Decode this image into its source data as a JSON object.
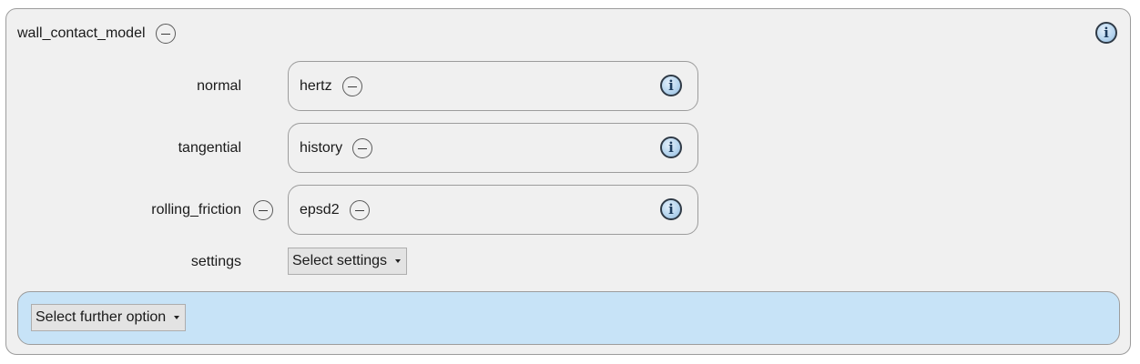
{
  "model": {
    "title": "wall_contact_model"
  },
  "rows": [
    {
      "label": "normal",
      "value": "hertz"
    },
    {
      "label": "tangential",
      "value": "history"
    },
    {
      "label": "rolling_friction",
      "value": "epsd2"
    }
  ],
  "settings": {
    "label": "settings",
    "dropdown_label": "Select settings"
  },
  "further": {
    "dropdown_label": "Select further option"
  },
  "colors": {
    "panel_bg": "#f0f0f0",
    "further_bg": "#c7e3f7",
    "border": "#9c9c9c",
    "info_icon": "#b8d6ef"
  },
  "icons": {
    "remove": "minus-circle-icon",
    "info": "info-icon",
    "dropdown": "caret-down-icon"
  }
}
